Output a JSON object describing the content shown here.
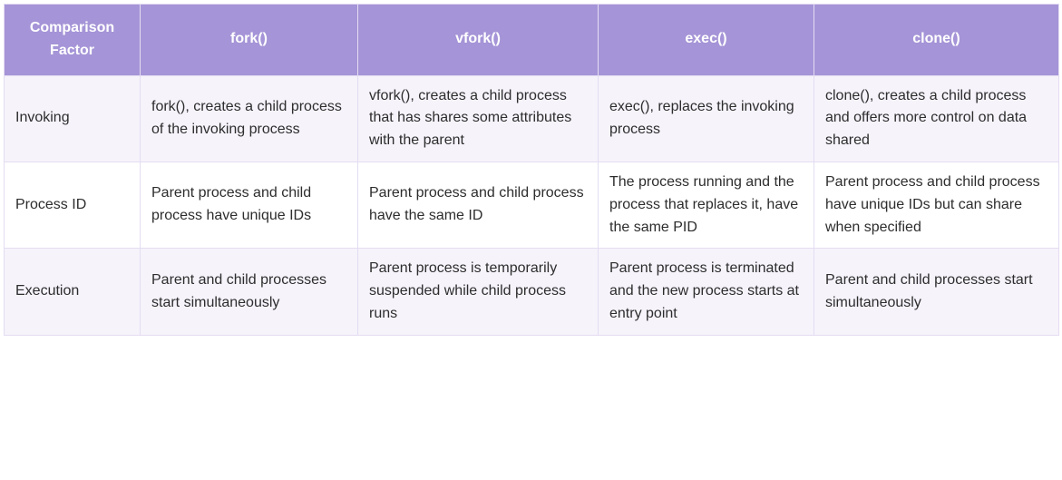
{
  "table": {
    "headers": [
      "Comparison Factor",
      "fork()",
      "vfork()",
      "exec()",
      "clone()"
    ],
    "rows": [
      {
        "factor": "Invoking",
        "fork": "fork(), creates a child process of the invoking process",
        "vfork": "vfork(), creates a child process that has shares some attributes with the parent",
        "exec": "exec(), replaces the invoking process",
        "clone": "clone(), creates a child process and offers more control on data shared"
      },
      {
        "factor": "Process ID",
        "fork": "Parent process and child process have unique IDs",
        "vfork": "Parent process and child process have the same ID",
        "exec": "The process running and the process that replaces it, have the same PID",
        "clone": "Parent process and child process have unique IDs but can share when specified"
      },
      {
        "factor": "Execution",
        "fork": "Parent and child processes start simultaneously",
        "vfork": "Parent process is temporarily suspended while child process runs",
        "exec": "Parent process is terminated and the new process starts at entry point",
        "clone": "Parent and child processes start simultaneously"
      }
    ]
  }
}
